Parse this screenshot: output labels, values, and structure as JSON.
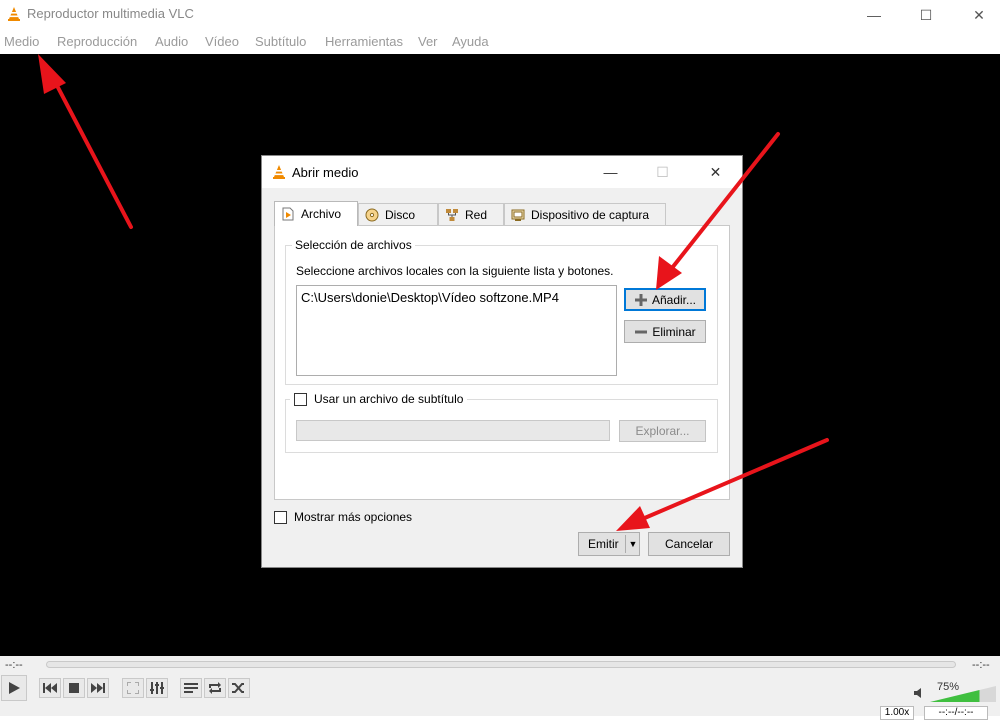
{
  "window": {
    "title": "Reproductor multimedia VLC",
    "minimize_glyph": "—",
    "maximize_glyph": "☐",
    "close_glyph": "✕"
  },
  "menu": {
    "items": [
      "Medio",
      "Reproducción",
      "Audio",
      "Vídeo",
      "Subtítulo",
      "Herramientas",
      "Ver",
      "Ayuda"
    ]
  },
  "dialog": {
    "title": "Abrir medio",
    "tabs": [
      {
        "label": "Archivo",
        "icon": "file-play-icon",
        "active": true
      },
      {
        "label": "Disco",
        "icon": "disc-icon",
        "active": false
      },
      {
        "label": "Red",
        "icon": "network-icon",
        "active": false
      },
      {
        "label": "Dispositivo de captura",
        "icon": "capture-device-icon",
        "active": false
      }
    ],
    "file_group": {
      "label": "Selección de archivos",
      "instructions": "Seleccione archivos locales con la siguiente lista y botones.",
      "files": [
        "C:\\Users\\donie\\Desktop\\Vídeo softzone.MP4"
      ],
      "add_button": "Añadir...",
      "remove_button": "Eliminar"
    },
    "subtitle_group": {
      "checkbox_label": "Usar un archivo de subtítulo",
      "checked": false,
      "path_value": "",
      "browse_button": "Explorar..."
    },
    "more_options": {
      "label": "Mostrar más opciones",
      "checked": false
    },
    "emit_button": "Emitir",
    "cancel_button": "Cancelar"
  },
  "player": {
    "elapsed": "--:--",
    "remaining": "--:--",
    "volume": "75%",
    "volume_level": 0.75,
    "speed": "1.00x",
    "status": "--:--/--:--"
  },
  "colors": {
    "annotation_arrow": "#e8141b",
    "vlc_orange": "#f08a00",
    "volume_green": "#3fbf3f"
  }
}
